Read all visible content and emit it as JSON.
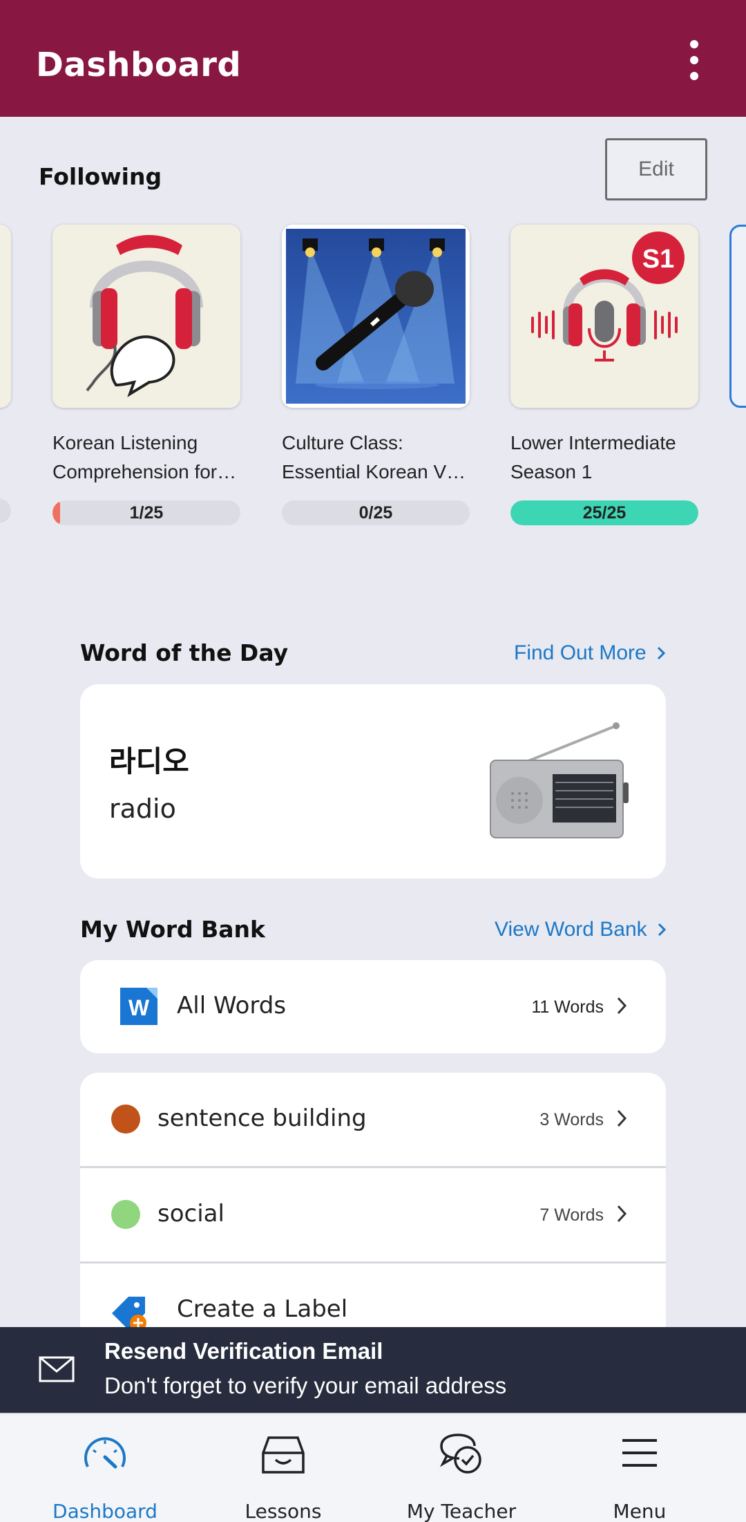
{
  "header": {
    "title": "Dashboard",
    "menu_icon": "more-vertical-icon"
  },
  "following": {
    "title": "Following",
    "edit_label": "Edit",
    "courses": [
      {
        "title_line1": "Korean Listening",
        "title_line2": "Comprehension for…",
        "progress_text": "1/25",
        "progress": 0.04,
        "color": "#f07060"
      },
      {
        "title_line1": "Culture Class:",
        "title_line2": "Essential Korean V…",
        "progress_text": "0/25",
        "progress": 0,
        "color": "#f07060"
      },
      {
        "title_line1": "Lower Intermediate",
        "title_line2": "Season 1",
        "progress_text": "25/25",
        "progress": 1,
        "color": "#3dd6b5",
        "badge": "S1"
      }
    ]
  },
  "word_of_day": {
    "title": "Word of the Day",
    "link": "Find Out More",
    "korean": "라디오",
    "english": "radio"
  },
  "word_bank": {
    "title": "My Word Bank",
    "link": "View Word Bank",
    "all_words": {
      "label": "All Words",
      "count": "11 Words",
      "icon_letter": "W"
    },
    "labels": [
      {
        "label": "sentence building",
        "count": "3 Words",
        "color": "#c0521a"
      },
      {
        "label": "social",
        "count": "7 Words",
        "color": "#8fd67e"
      }
    ],
    "create_label": "Create a Label"
  },
  "banner": {
    "title": "Resend Verification Email",
    "subtitle": "Don't forget to verify your email address"
  },
  "nav": [
    {
      "label": "Dashboard",
      "icon": "dashboard-gauge-icon",
      "active": true
    },
    {
      "label": "Lessons",
      "icon": "lessons-box-icon"
    },
    {
      "label": "My Teacher",
      "icon": "chat-bubbles-icon"
    },
    {
      "label": "Menu",
      "icon": "hamburger-menu-icon"
    }
  ],
  "colors": {
    "header": "#881842",
    "accent": "#1b78c6",
    "banner": "#272d3e"
  }
}
